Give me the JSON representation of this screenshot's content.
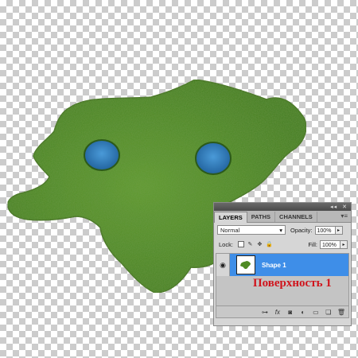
{
  "panel": {
    "tabs": [
      "LAYERS",
      "PATHS",
      "CHANNELS"
    ],
    "blend_mode": "Normal",
    "opacity_label": "Opacity:",
    "opacity_value": "100%",
    "lock_label": "Lock:",
    "fill_label": "Fill:",
    "fill_value": "100%",
    "layer_name": "Shape 1",
    "bottom_icons": [
      "link-icon",
      "fx-icon",
      "mask-icon",
      "adjustment-icon",
      "group-icon",
      "new-layer-icon",
      "trash-icon"
    ]
  },
  "caption": "Поверхность 1",
  "colors": {
    "grass": "#4f8a24",
    "water": "#2f7fc4",
    "selection": "#3e8ee8",
    "caption": "#d0141c"
  }
}
